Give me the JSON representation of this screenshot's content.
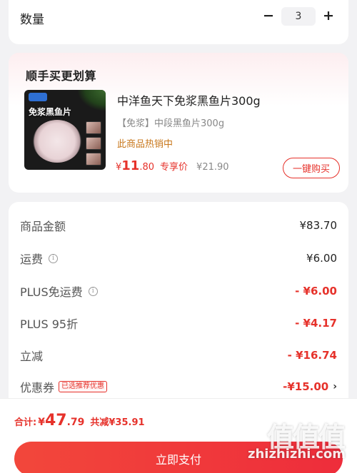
{
  "quantity": {
    "label": "数量",
    "minus": "−",
    "value": "3",
    "plus": "+"
  },
  "bundle": {
    "title": "顺手买更划算",
    "product": {
      "image_label": "免浆黑鱼片",
      "name": "中洋鱼天下免浆黑鱼片300g",
      "spec": "【免浆】中段黑鱼片300g",
      "hot": "此商品热销中",
      "price_currency": "¥",
      "price_int": "11",
      "price_dec": ".80",
      "price_tag": "专享价",
      "original_price": "¥21.90",
      "buy_label": "一键购买"
    }
  },
  "summary": {
    "rows": [
      {
        "label": "商品金额",
        "value": "¥83.70"
      },
      {
        "label": "运费",
        "value": "¥6.00"
      },
      {
        "label": "PLUS免运费",
        "value": "- ¥6.00"
      },
      {
        "label": "PLUS 95折",
        "value": "- ¥4.17"
      },
      {
        "label": "立减",
        "value": "- ¥16.74"
      },
      {
        "label": "优惠券",
        "badge": "已选推荐优惠",
        "value": "-¥15.00"
      }
    ],
    "info_glyph": "i",
    "chevron": "›"
  },
  "footer": {
    "total_label": "合计:",
    "total_currency": "¥",
    "total_int": "47",
    "total_dec": ".79",
    "saved": "共减¥35.91",
    "pay_label": "立即支付"
  },
  "watermark": {
    "logo": "值值值",
    "url": "zhizhizhi.com"
  },
  "colors": {
    "accent": "#e6322b",
    "hot": "#c8771b",
    "background": "#f2f2f4"
  }
}
